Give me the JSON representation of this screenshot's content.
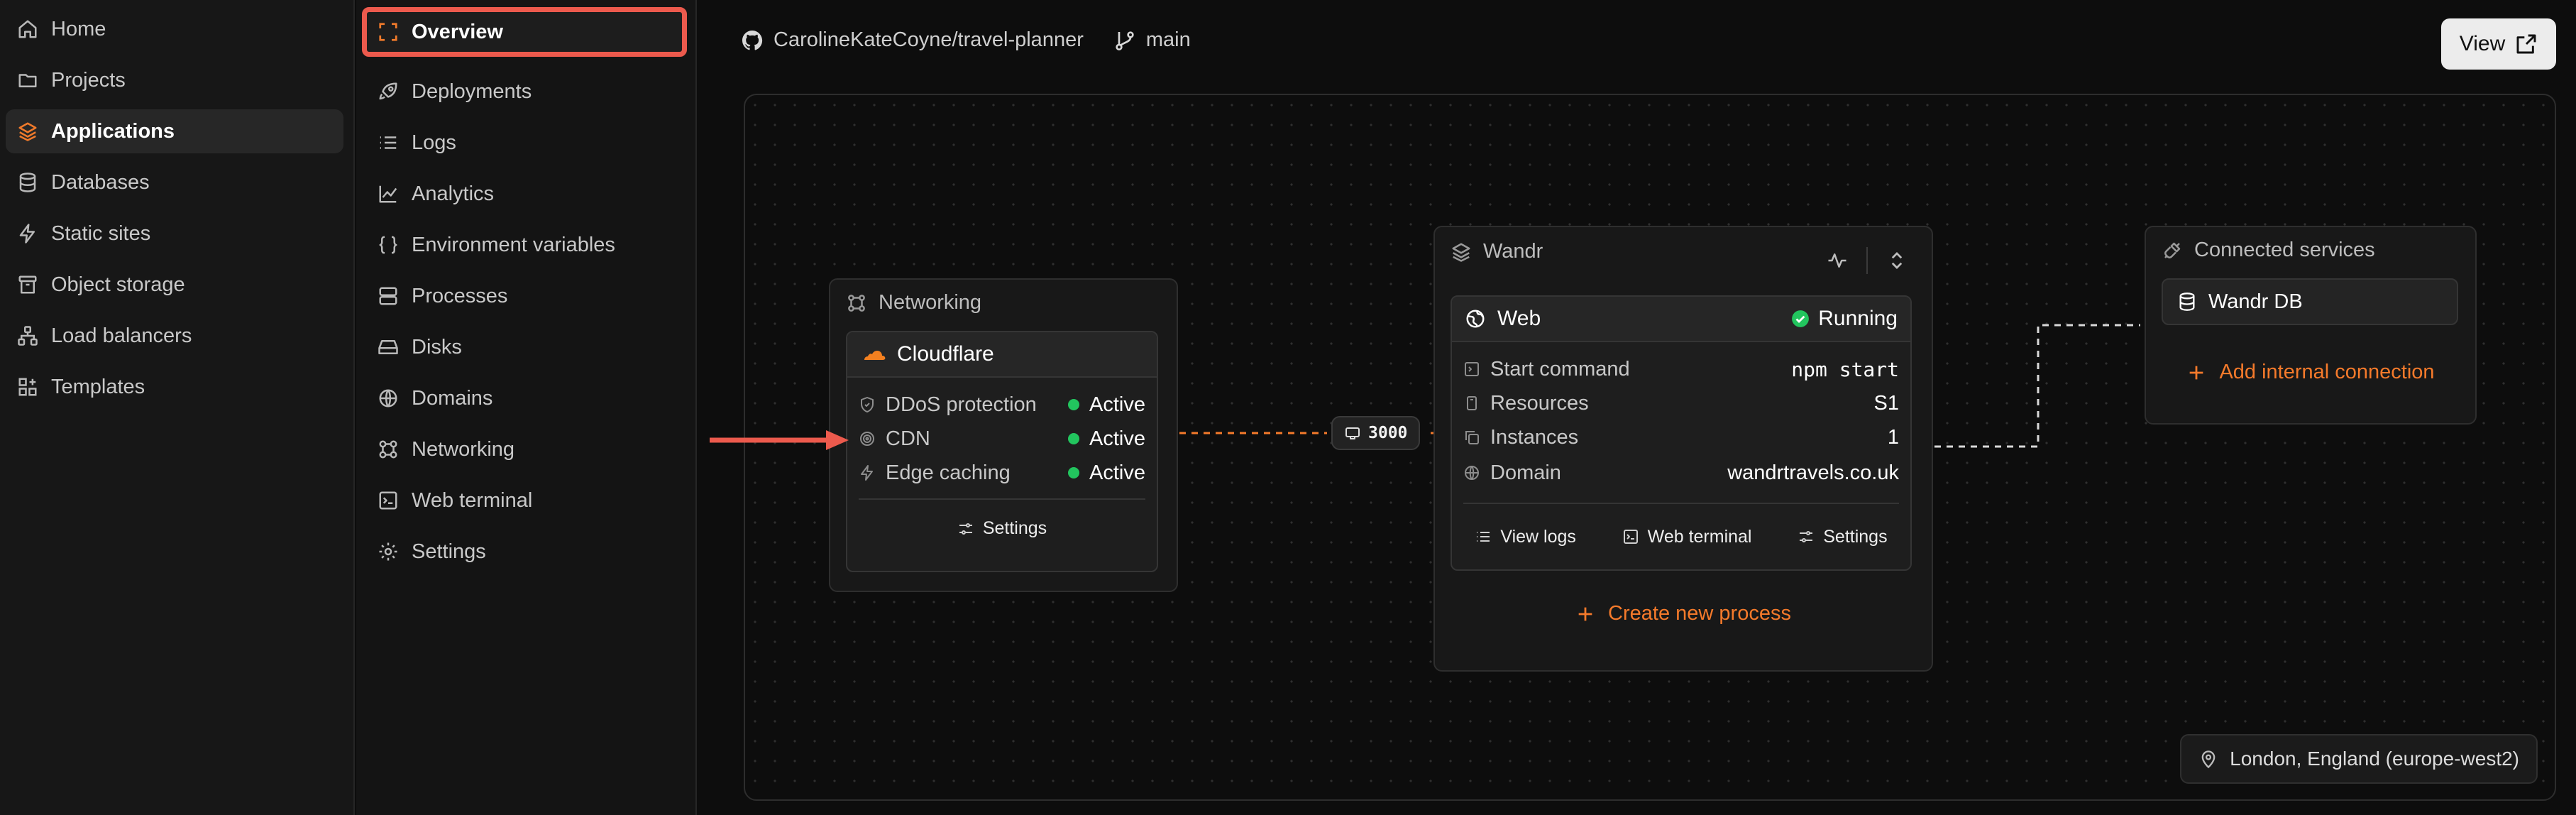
{
  "sidebar": {
    "items": [
      {
        "label": "Home",
        "icon": "home-icon"
      },
      {
        "label": "Projects",
        "icon": "folder-icon"
      },
      {
        "label": "Applications",
        "icon": "layers-icon",
        "active": true
      },
      {
        "label": "Databases",
        "icon": "database-icon"
      },
      {
        "label": "Static sites",
        "icon": "bolt-icon"
      },
      {
        "label": "Object storage",
        "icon": "archive-icon"
      },
      {
        "label": "Load balancers",
        "icon": "network-icon"
      },
      {
        "label": "Templates",
        "icon": "template-icon"
      }
    ]
  },
  "subnav": {
    "items": [
      {
        "label": "Overview",
        "icon": "overview-icon",
        "active": true
      },
      {
        "label": "Deployments",
        "icon": "rocket-icon"
      },
      {
        "label": "Logs",
        "icon": "list-icon"
      },
      {
        "label": "Analytics",
        "icon": "chart-line-icon"
      },
      {
        "label": "Environment variables",
        "icon": "braces-icon"
      },
      {
        "label": "Processes",
        "icon": "server-icon"
      },
      {
        "label": "Disks",
        "icon": "disk-icon"
      },
      {
        "label": "Domains",
        "icon": "globe-icon"
      },
      {
        "label": "Networking",
        "icon": "network-icon"
      },
      {
        "label": "Web terminal",
        "icon": "terminal-icon"
      },
      {
        "label": "Settings",
        "icon": "gear-icon"
      }
    ]
  },
  "header": {
    "repo": "CarolineKateCoyne/travel-planner",
    "branch": "main",
    "view_label": "View"
  },
  "networking": {
    "title": "Networking",
    "provider": "Cloudflare",
    "rows": [
      {
        "label": "DDoS protection",
        "status": "Active"
      },
      {
        "label": "CDN",
        "status": "Active"
      },
      {
        "label": "Edge caching",
        "status": "Active"
      }
    ],
    "settings_label": "Settings"
  },
  "port": {
    "value": "3000"
  },
  "app": {
    "title": "Wandr",
    "process": {
      "name": "Web",
      "status": "Running",
      "rows": [
        {
          "label": "Start command",
          "value": "npm start",
          "mono": true
        },
        {
          "label": "Resources",
          "value": "S1"
        },
        {
          "label": "Instances",
          "value": "1"
        },
        {
          "label": "Domain",
          "value": "wandrtravels.co.uk"
        }
      ],
      "actions": {
        "logs": "View logs",
        "terminal": "Web terminal",
        "settings": "Settings"
      }
    },
    "create_label": "Create new process"
  },
  "connected": {
    "title": "Connected services",
    "db_name": "Wandr DB",
    "add_label": "Add internal connection"
  },
  "location": {
    "label": "London, England (europe-west2)"
  },
  "colors": {
    "accent": "#f57a2b",
    "status_active": "#22c55e",
    "highlight_box": "#ec5a4d"
  }
}
